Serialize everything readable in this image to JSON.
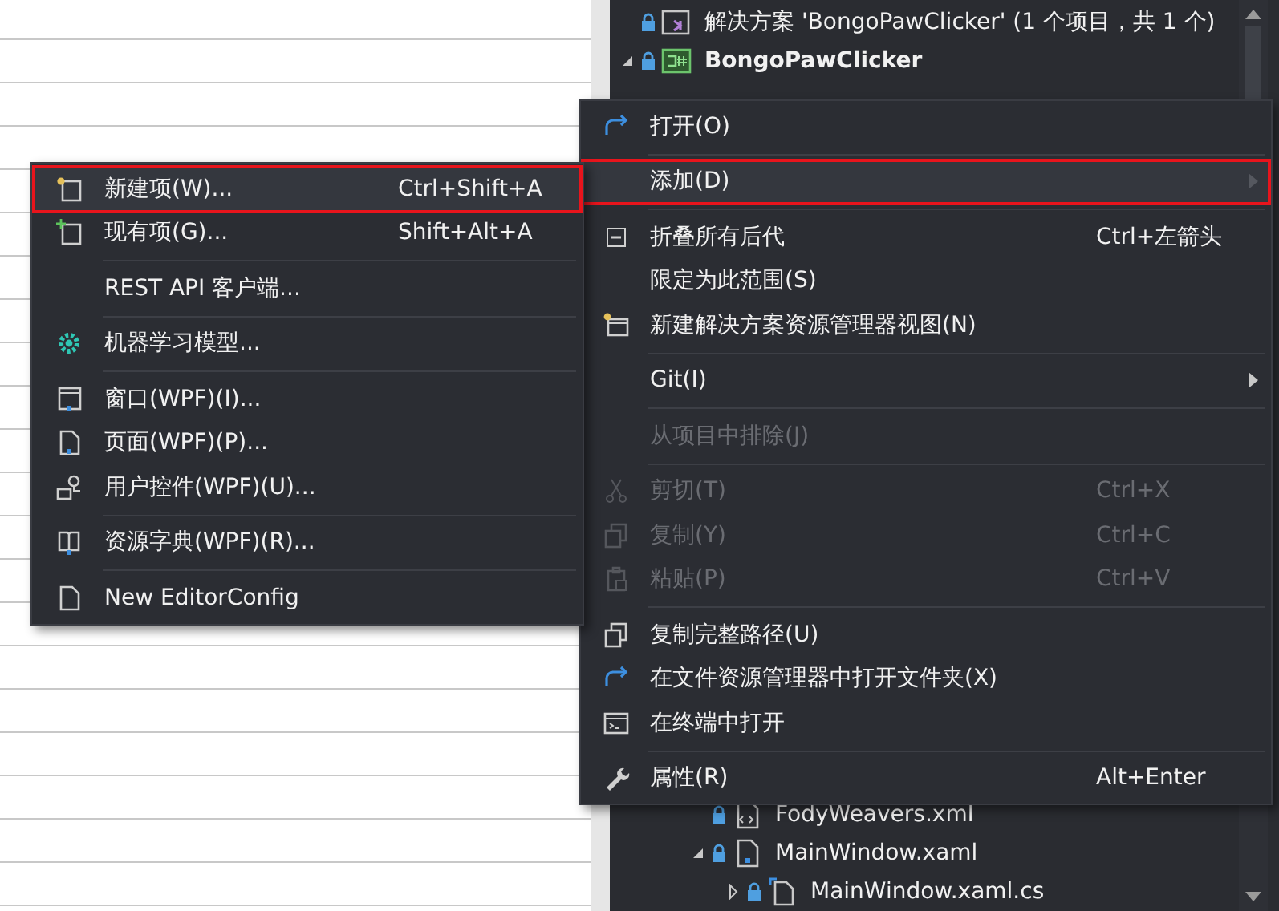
{
  "solution_explorer": {
    "top_rows": [
      {
        "label": "解决方案 'BongoPawClicker' (1 个项目，共 1 个)",
        "kind": "solution",
        "bold": false
      },
      {
        "label": "BongoPawClicker",
        "kind": "project",
        "bold": true,
        "expanded": true
      }
    ],
    "bottom_rows": [
      {
        "label": "FodyWeavers.xml",
        "kind": "xml"
      },
      {
        "label": "MainWindow.xaml",
        "kind": "xaml",
        "expanded": true,
        "children": [
          {
            "label": "MainWindow.xaml.cs",
            "kind": "code",
            "expanded": false
          }
        ]
      }
    ]
  },
  "context_menu": [
    {
      "kind": "item",
      "label": "打开(O)",
      "disabled": false,
      "highlighted": false
    },
    {
      "kind": "separator"
    },
    {
      "kind": "item",
      "label": "添加(D)",
      "submenu": true,
      "disabled": false,
      "highlighted": true
    },
    {
      "kind": "separator"
    },
    {
      "kind": "item",
      "label": "折叠所有后代",
      "shortcut": "Ctrl+左箭头",
      "disabled": false,
      "highlighted": false
    },
    {
      "kind": "item",
      "label": "限定为此范围(S)",
      "disabled": false,
      "highlighted": false
    },
    {
      "kind": "item",
      "label": "新建解决方案资源管理器视图(N)",
      "disabled": false,
      "highlighted": false
    },
    {
      "kind": "separator"
    },
    {
      "kind": "item",
      "label": "Git(I)",
      "submenu": true,
      "disabled": false,
      "highlighted": false
    },
    {
      "kind": "separator"
    },
    {
      "kind": "item",
      "label": "从项目中排除(J)",
      "disabled": true,
      "highlighted": false
    },
    {
      "kind": "separator"
    },
    {
      "kind": "item",
      "label": "剪切(T)",
      "shortcut": "Ctrl+X",
      "disabled": true,
      "highlighted": false
    },
    {
      "kind": "item",
      "label": "复制(Y)",
      "shortcut": "Ctrl+C",
      "disabled": true,
      "highlighted": false
    },
    {
      "kind": "item",
      "label": "粘贴(P)",
      "shortcut": "Ctrl+V",
      "disabled": true,
      "highlighted": false
    },
    {
      "kind": "separator"
    },
    {
      "kind": "item",
      "label": "复制完整路径(U)",
      "disabled": false,
      "highlighted": false
    },
    {
      "kind": "item",
      "label": "在文件资源管理器中打开文件夹(X)",
      "disabled": false,
      "highlighted": false
    },
    {
      "kind": "item",
      "label": "在终端中打开",
      "disabled": false,
      "highlighted": false
    },
    {
      "kind": "separator"
    },
    {
      "kind": "item",
      "label": "属性(R)",
      "shortcut": "Alt+Enter",
      "disabled": false,
      "highlighted": false
    }
  ],
  "add_submenu": [
    {
      "kind": "item",
      "label": "新建项(W)...",
      "shortcut": "Ctrl+Shift+A",
      "highlighted": true
    },
    {
      "kind": "item",
      "label": "现有项(G)...",
      "shortcut": "Shift+Alt+A",
      "highlighted": false
    },
    {
      "kind": "separator"
    },
    {
      "kind": "item",
      "label": "REST API 客户端...",
      "highlighted": false
    },
    {
      "kind": "separator"
    },
    {
      "kind": "item",
      "label": "机器学习模型...",
      "highlighted": false
    },
    {
      "kind": "separator"
    },
    {
      "kind": "item",
      "label": "窗口(WPF)(I)...",
      "highlighted": false
    },
    {
      "kind": "item",
      "label": "页面(WPF)(P)...",
      "highlighted": false
    },
    {
      "kind": "item",
      "label": "用户控件(WPF)(U)...",
      "highlighted": false
    },
    {
      "kind": "separator"
    },
    {
      "kind": "item",
      "label": "资源字典(WPF)(R)...",
      "highlighted": false
    },
    {
      "kind": "separator"
    },
    {
      "kind": "item",
      "label": "New EditorConfig",
      "highlighted": false
    }
  ]
}
